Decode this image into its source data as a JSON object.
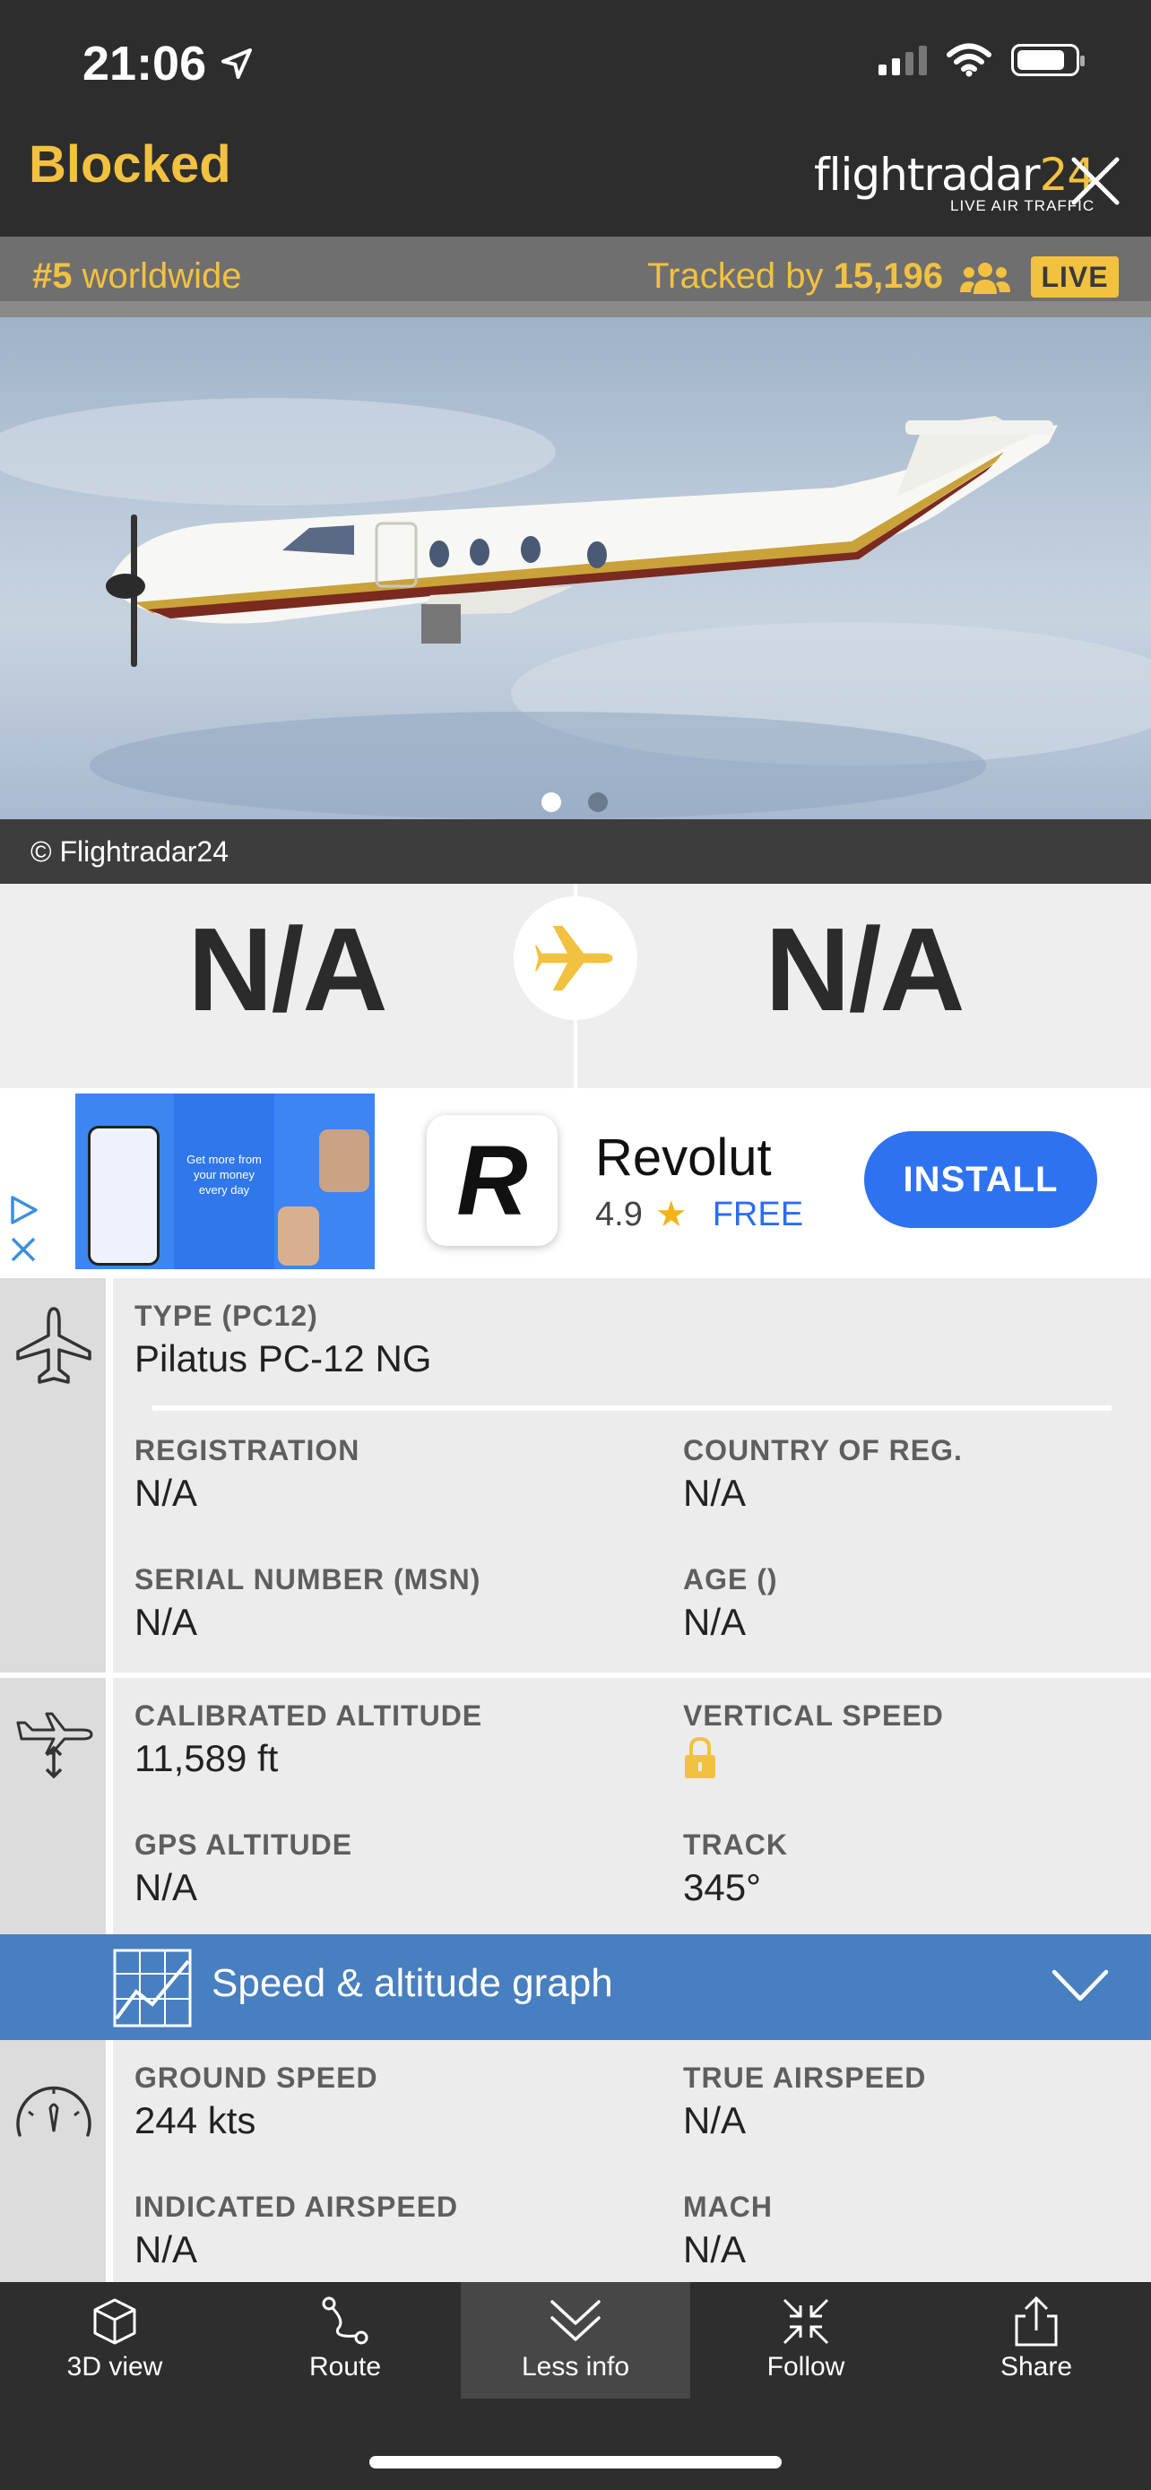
{
  "status_bar": {
    "time": "21:06"
  },
  "header": {
    "title": "Blocked",
    "logo_main": "flightradar",
    "logo_num": "24",
    "logo_sub": "LIVE AIR TRAFFIC"
  },
  "rank": {
    "rank_num": "#5",
    "rank_label": " worldwide",
    "tracked_prefix": "Tracked by ",
    "tracked_count": "15,196",
    "live": "LIVE"
  },
  "photo": {
    "credit": "© Flightradar24",
    "page_index": 1,
    "page_count": 2
  },
  "route": {
    "origin": "N/A",
    "destination": "N/A"
  },
  "ad": {
    "image_text": "Get more from your money every day",
    "app_icon_letter": "R",
    "app_name": "Revolut",
    "rating": "4.9",
    "price": "FREE",
    "install": "INSTALL"
  },
  "aircraft": {
    "type_label": "TYPE (PC12)",
    "type_value": "Pilatus PC-12 NG",
    "registration_label": "REGISTRATION",
    "registration_value": "N/A",
    "country_label": "COUNTRY OF REG.",
    "country_value": "N/A",
    "serial_label": "SERIAL NUMBER (MSN)",
    "serial_value": "N/A",
    "age_label": "AGE ()",
    "age_value": "N/A"
  },
  "altitude": {
    "cal_alt_label": "CALIBRATED ALTITUDE",
    "cal_alt_value": "11,589 ft",
    "vs_label": "VERTICAL SPEED",
    "gps_alt_label": "GPS ALTITUDE",
    "gps_alt_value": "N/A",
    "track_label": "TRACK",
    "track_value": "345°"
  },
  "graph": {
    "title": "Speed & altitude graph"
  },
  "speed": {
    "ground_label": "GROUND SPEED",
    "ground_value": "244 kts",
    "tas_label": "TRUE AIRSPEED",
    "tas_value": "N/A",
    "ias_label": "INDICATED AIRSPEED",
    "ias_value": "N/A",
    "mach_label": "MACH",
    "mach_value": "N/A"
  },
  "toolbar": {
    "items": [
      {
        "label": "3D view",
        "icon": "cube-icon"
      },
      {
        "label": "Route",
        "icon": "route-icon"
      },
      {
        "label": "Less info",
        "icon": "chevron-down-icon"
      },
      {
        "label": "Follow",
        "icon": "follow-icon"
      },
      {
        "label": "Share",
        "icon": "share-icon"
      }
    ]
  },
  "colors": {
    "accent": "#f2c140",
    "graph_bar": "#477fc0",
    "install": "#2f72f0",
    "dark": "#2d2d2d"
  }
}
